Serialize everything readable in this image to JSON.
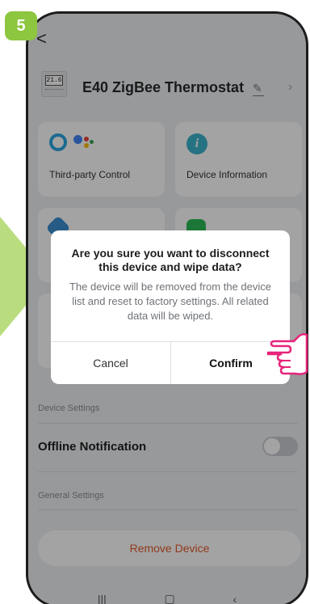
{
  "step": "5",
  "header": {
    "back_glyph": "<",
    "thermostat_display": "21.6",
    "title": "E40 ZigBee Thermostat",
    "edit_icon": "pencil-icon",
    "chevron_icon": "chevron-right-icon"
  },
  "cards": [
    {
      "label": "Third-party Control",
      "icon": "alexa-google-icon"
    },
    {
      "label": "Device Information",
      "icon": "info-icon"
    },
    {
      "label": "",
      "icon": "blue-app-icon"
    },
    {
      "label": "",
      "icon": "green-app-icon"
    }
  ],
  "settings": {
    "device_settings_label": "Device Settings",
    "offline_notification_label": "Offline Notification",
    "offline_notification_on": false,
    "general_settings_label": "General Settings",
    "remove_device_label": "Remove Device"
  },
  "dialog": {
    "title": "Are you sure you want to disconnect this device and wipe data?",
    "message": "The device will be removed from the device list and reset to factory settings. All related data will be wiped.",
    "cancel_label": "Cancel",
    "confirm_label": "Confirm"
  },
  "colors": {
    "accent_green": "#8dc63f",
    "remove_text": "#e25c2b",
    "hand_outline": "#e6247a"
  }
}
